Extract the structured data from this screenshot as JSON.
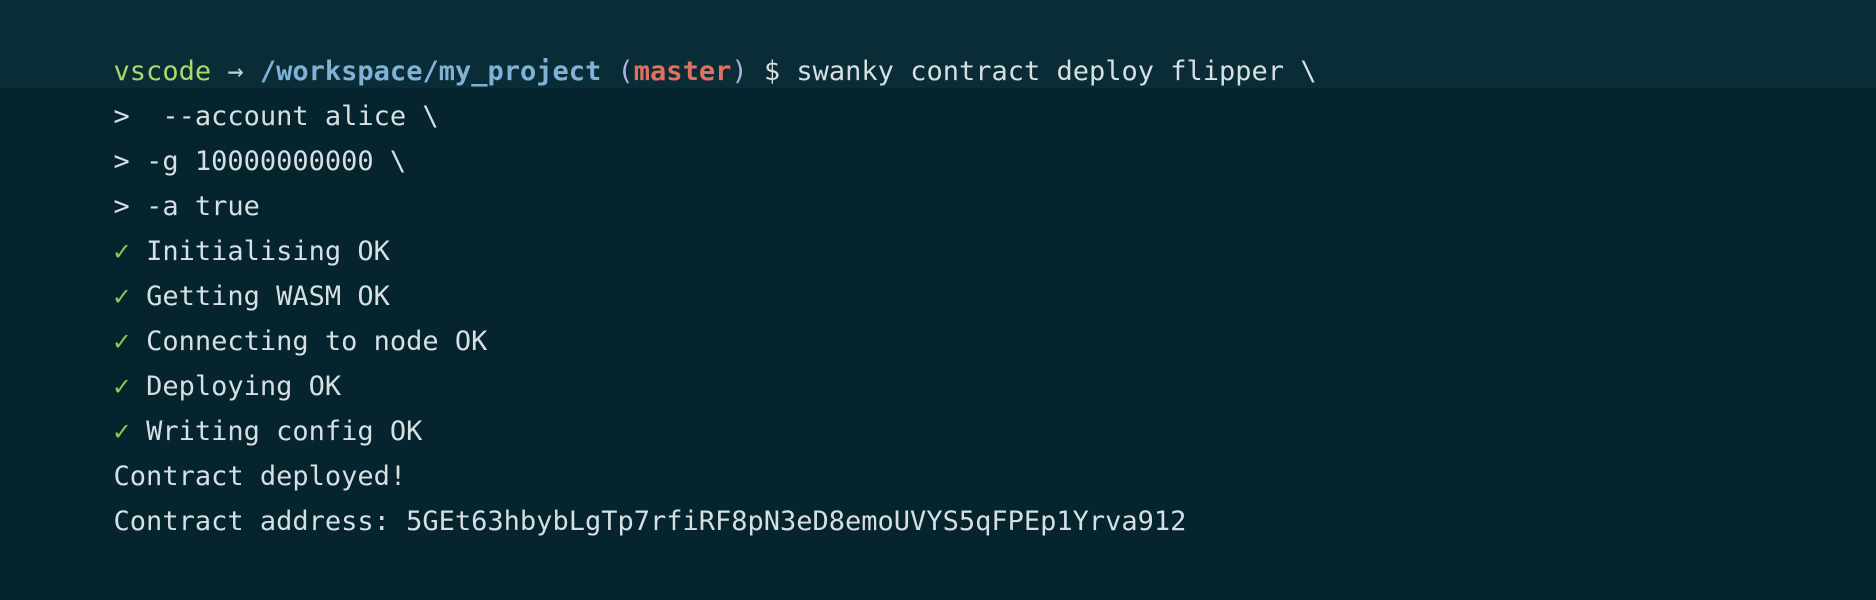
{
  "terminal": {
    "background_color": "#05242e",
    "foreground_color": "#d6dfe2",
    "prompt": {
      "user": "vscode",
      "arrow_icon": "→",
      "path": "/workspace/my_project",
      "paren_open": "(",
      "branch": "master",
      "paren_close": ")",
      "sigil": "$",
      "command": "swanky contract deploy flipper \\"
    },
    "continuation_prompt": ">",
    "continuation_lines": [
      "  --account alice \\",
      " -g 10000000000 \\",
      " -a true"
    ],
    "check_icon": "✓",
    "steps": [
      "Initialising OK",
      "Getting WASM OK",
      "Connecting to node OK",
      "Deploying OK",
      "Writing config OK"
    ],
    "output": [
      "Contract deployed!",
      "Contract address: 5GEt63hbybLgTp7rfiRF8pN3eD8emoUVYS5qFPEp1Yrva912"
    ],
    "colors": {
      "user": "#a7d96d",
      "path": "#7fb2d4",
      "branch": "#e0705f",
      "paren": "#b0b0dd",
      "check": "#8fc953",
      "text": "#d6dfe2"
    }
  }
}
